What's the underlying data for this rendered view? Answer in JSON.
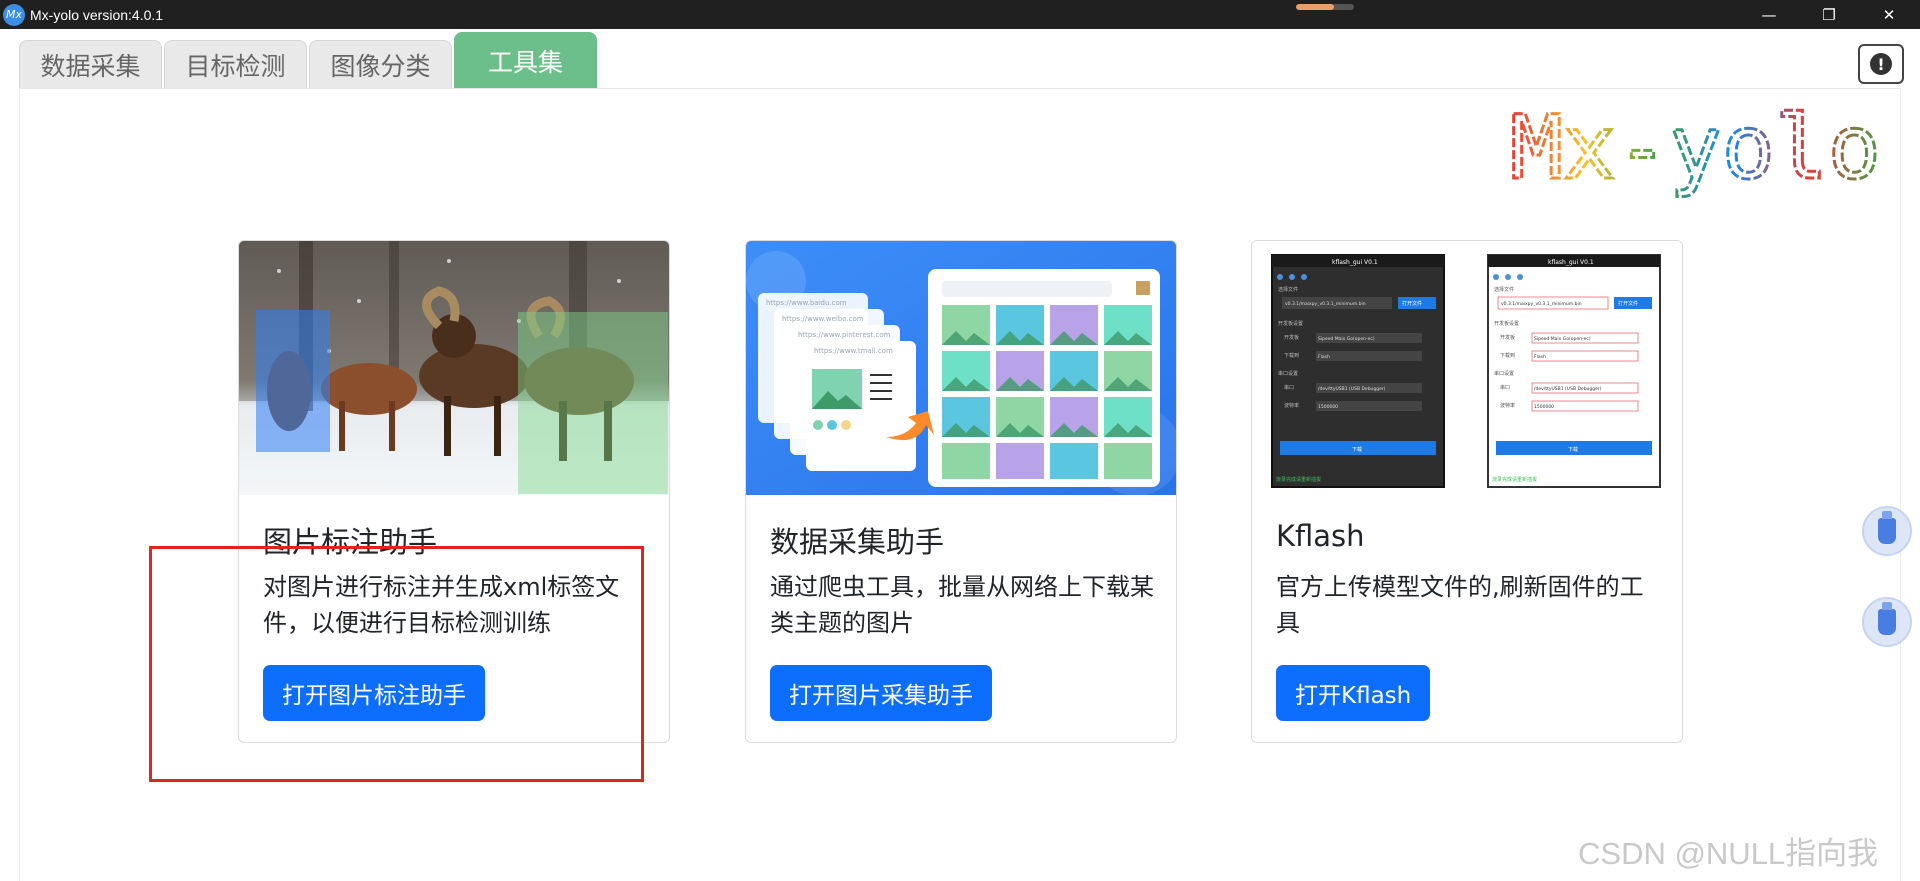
{
  "window": {
    "title": "Mx-yolo version:4.0.1",
    "app_icon_text": "Mx",
    "minimize": "—",
    "maximize": "❐",
    "close": "✕"
  },
  "tabs": [
    {
      "label": "数据采集",
      "active": false
    },
    {
      "label": "目标检测",
      "active": false
    },
    {
      "label": "图像分类",
      "active": false
    },
    {
      "label": "工具集",
      "active": true
    }
  ],
  "logo_text": "Mx-yolo",
  "info_icon": "!",
  "cards": [
    {
      "title": "图片标注助手",
      "text": "对图片进行标注并生成xml标签文件，以便进行目标检测训练",
      "button": "打开图片标注助手"
    },
    {
      "title": "数据采集助手",
      "text": "通过爬虫工具，批量从网络上下载某类主题的图片",
      "button": "打开图片采集助手"
    },
    {
      "title": "Kflash",
      "text": "官方上传模型文件的,刷新固件的工具",
      "button": "打开Kflash"
    }
  ],
  "crawler_image": {
    "urls": [
      "https://www.baidu.com",
      "https://www.weibo.com",
      "https://www.pinterest.com",
      "https://www.tmall.com"
    ]
  },
  "kflash_image": {
    "window_title": "kflash_gui V0.1",
    "firmware_label": "选择文件",
    "firmware_path": "v0.3.1/maixpy_v0.3.1_minimum.bin",
    "open_file_button": "打开文件",
    "section_board": "开发板设置",
    "board_label": "开发板",
    "board_value": "Sipeed Maix Go(open-ec)",
    "burn_label": "下载到",
    "burn_value": "Flash",
    "section_serial": "串口设置",
    "port_label": "串口",
    "port_value": "/dev/ttyUSB1 (USB Debugger)",
    "baud_label": "波特率",
    "baud_value": "1500000",
    "download_button": "下载",
    "footer_text": "烧录完成请重新插拔"
  },
  "watermark": "CSDN @NULL指向我",
  "colors": {
    "active_tab": "#6cbf8a",
    "primary_button": "#0d6efd",
    "highlight_box": "#e0261c"
  }
}
